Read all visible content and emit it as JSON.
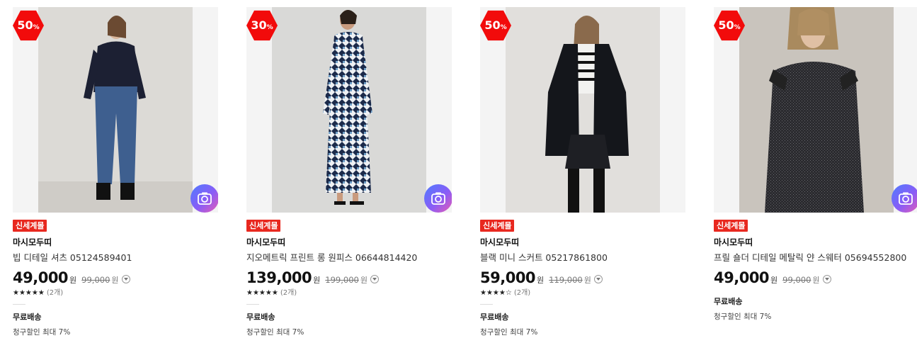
{
  "products": [
    {
      "discount": "50",
      "discount_unit": "%",
      "badge": "신세계몰",
      "brand": "마시모두띠",
      "name": "빕 디테일 셔츠 05124589401",
      "price": "49,000",
      "won": "원",
      "original_price": "99,000",
      "original_won": "원",
      "stars": "★★★★★",
      "review_count": "(2개)",
      "shipping": "무료배송",
      "billing_discount": "청구할인 최대 7%"
    },
    {
      "discount": "30",
      "discount_unit": "%",
      "badge": "신세계몰",
      "brand": "마시모두띠",
      "name": "지오메트릭 프린트 롱 원피스 06644814420",
      "price": "139,000",
      "won": "원",
      "original_price": "199,000",
      "original_won": "원",
      "stars": "★★★★★",
      "review_count": "(2개)",
      "shipping": "무료배송",
      "billing_discount": "청구할인 최대 7%"
    },
    {
      "discount": "50",
      "discount_unit": "%",
      "badge": "신세계몰",
      "brand": "마시모두띠",
      "name": "블랙 미니 스커트 05217861800",
      "price": "59,000",
      "won": "원",
      "original_price": "119,000",
      "original_won": "원",
      "stars": "★★★★☆",
      "review_count": "(2개)",
      "shipping": "무료배송",
      "billing_discount": "청구할인 최대 7%"
    },
    {
      "discount": "50",
      "discount_unit": "%",
      "badge": "신세계몰",
      "brand": "마시모두띠",
      "name": "프릴 숄더 디테일 메탈릭 얀 스웨터 05694552800",
      "price": "49,000",
      "won": "원",
      "original_price": "99,000",
      "original_won": "원",
      "shipping": "무료배송",
      "billing_discount": "청구할인 최대 7%"
    }
  ],
  "icons": {
    "discount_badge": "hexagon-badge-icon",
    "image_search": "camera-icon",
    "price_info": "chevron-down-icon",
    "rating": "star-icon"
  },
  "colors": {
    "discount": "#f20b0b",
    "badge": "#e8281f",
    "image_search_gradient": [
      "#4f7cff",
      "#8a5cf6",
      "#e85bb4"
    ]
  }
}
